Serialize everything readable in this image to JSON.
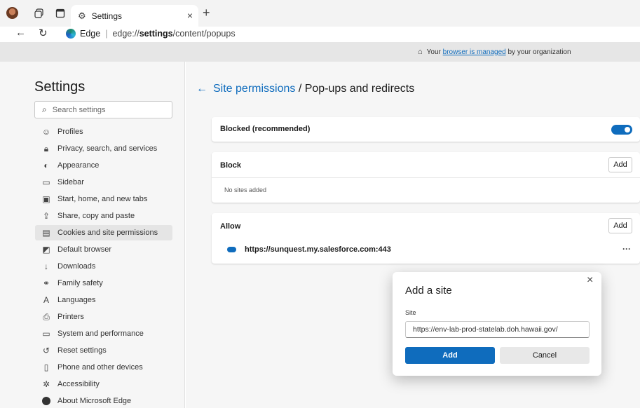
{
  "browser": {
    "tab_title": "Settings",
    "new_tab_icon": "plus-icon",
    "address": {
      "prefix": "Edge",
      "host": "edge://",
      "path_bold": "settings",
      "path_rest": "/content/popups"
    }
  },
  "banner": {
    "pre": "Your",
    "link": "browser is managed",
    "post": "by your organization"
  },
  "sidebar": {
    "title": "Settings",
    "search_placeholder": "Search settings",
    "items": [
      {
        "label": "Profiles",
        "icon": "profile-icon"
      },
      {
        "label": "Privacy, search, and services",
        "icon": "lock-icon"
      },
      {
        "label": "Appearance",
        "icon": "appearance-icon"
      },
      {
        "label": "Sidebar",
        "icon": "sidebar-icon"
      },
      {
        "label": "Start, home, and new tabs",
        "icon": "home-tabs-icon"
      },
      {
        "label": "Share, copy and paste",
        "icon": "share-icon"
      },
      {
        "label": "Cookies and site permissions",
        "icon": "cookies-icon"
      },
      {
        "label": "Default browser",
        "icon": "default-browser-icon"
      },
      {
        "label": "Downloads",
        "icon": "download-icon"
      },
      {
        "label": "Family safety",
        "icon": "family-icon"
      },
      {
        "label": "Languages",
        "icon": "language-icon"
      },
      {
        "label": "Printers",
        "icon": "printer-icon"
      },
      {
        "label": "System and performance",
        "icon": "system-icon"
      },
      {
        "label": "Reset settings",
        "icon": "reset-icon"
      },
      {
        "label": "Phone and other devices",
        "icon": "phone-icon"
      },
      {
        "label": "Accessibility",
        "icon": "accessibility-icon"
      },
      {
        "label": "About Microsoft Edge",
        "icon": "edge-logo-icon"
      }
    ]
  },
  "main": {
    "breadcrumb_link": "Site permissions",
    "breadcrumb_sep": " / ",
    "breadcrumb_current": "Pop-ups and redirects",
    "blocked_label": "Blocked (recommended)",
    "blocked_toggle_on": true,
    "block_section": {
      "title": "Block",
      "add_label": "Add",
      "empty_text": "No sites added"
    },
    "allow_section": {
      "title": "Allow",
      "add_label": "Add",
      "sites": [
        "https://sunquest.my.salesforce.com:443"
      ]
    },
    "more_label": "···"
  },
  "dialog": {
    "title": "Add a site",
    "field_label": "Site",
    "field_value": "https://env-lab-prod-statelab.doh.hawaii.gov/",
    "add_label": "Add",
    "cancel_label": "Cancel"
  },
  "colors": {
    "accent": "#0f6cbd",
    "link": "#0f6cbd"
  }
}
